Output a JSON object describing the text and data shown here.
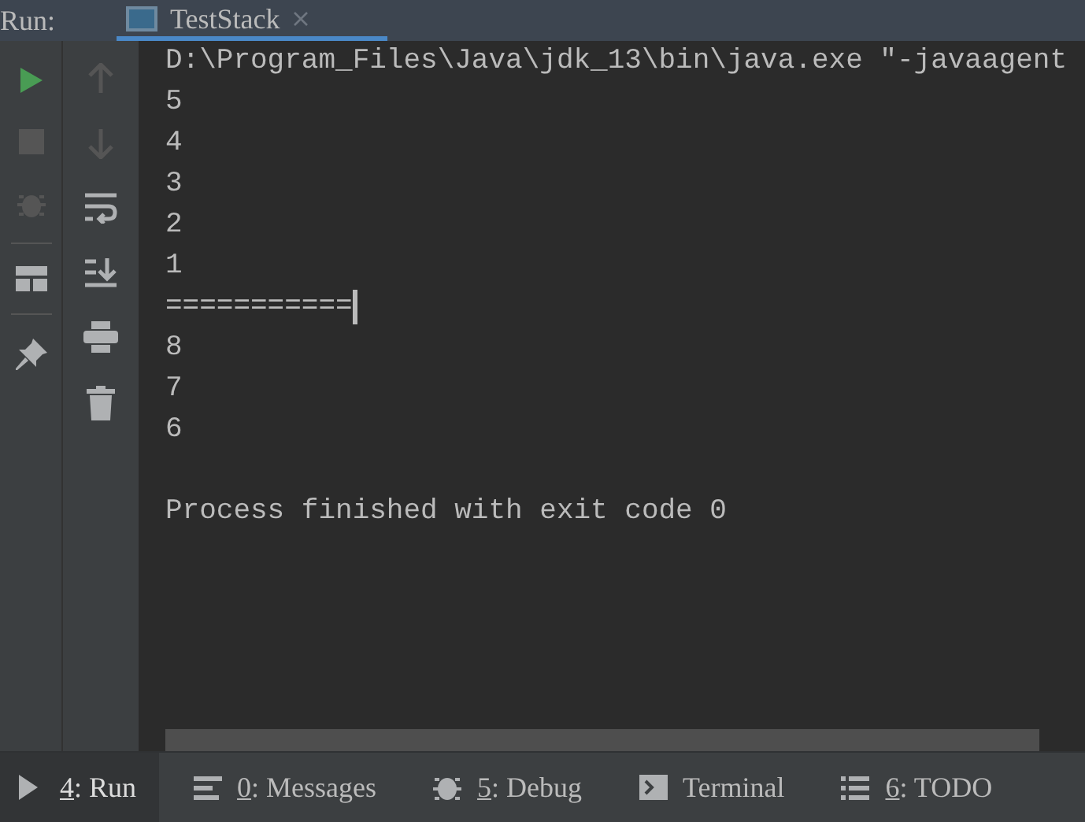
{
  "header": {
    "label": "Run:",
    "tab": {
      "title": "TestStack",
      "selected": true
    }
  },
  "console": {
    "lines": [
      {
        "kind": "text",
        "text": "D:\\Program_Files\\Java\\jdk_13\\bin\\java.exe \"-javaagent",
        "cursor": false
      },
      {
        "kind": "text",
        "text": "5",
        "cursor": false
      },
      {
        "kind": "text",
        "text": "4",
        "cursor": false
      },
      {
        "kind": "text",
        "text": "3",
        "cursor": false
      },
      {
        "kind": "text",
        "text": "2",
        "cursor": false
      },
      {
        "kind": "text",
        "text": "1",
        "cursor": false
      },
      {
        "kind": "text",
        "text": "===========",
        "cursor": true
      },
      {
        "kind": "text",
        "text": "8",
        "cursor": false
      },
      {
        "kind": "text",
        "text": "7",
        "cursor": false
      },
      {
        "kind": "text",
        "text": "6",
        "cursor": false
      },
      {
        "kind": "blank"
      },
      {
        "kind": "text",
        "text": "Process finished with exit code 0",
        "cursor": false
      }
    ]
  },
  "bottom_tabs": [
    {
      "kind": "run",
      "mnemonic": "4",
      "label": ": Run",
      "selected": true
    },
    {
      "kind": "messages",
      "mnemonic": "0",
      "label": ": Messages",
      "selected": false
    },
    {
      "kind": "debug",
      "mnemonic": "5",
      "label": ": Debug",
      "selected": false
    },
    {
      "kind": "terminal",
      "label": "Terminal",
      "selected": false
    },
    {
      "kind": "todo",
      "mnemonic": "6",
      "label": ": TODO",
      "selected": false
    }
  ]
}
